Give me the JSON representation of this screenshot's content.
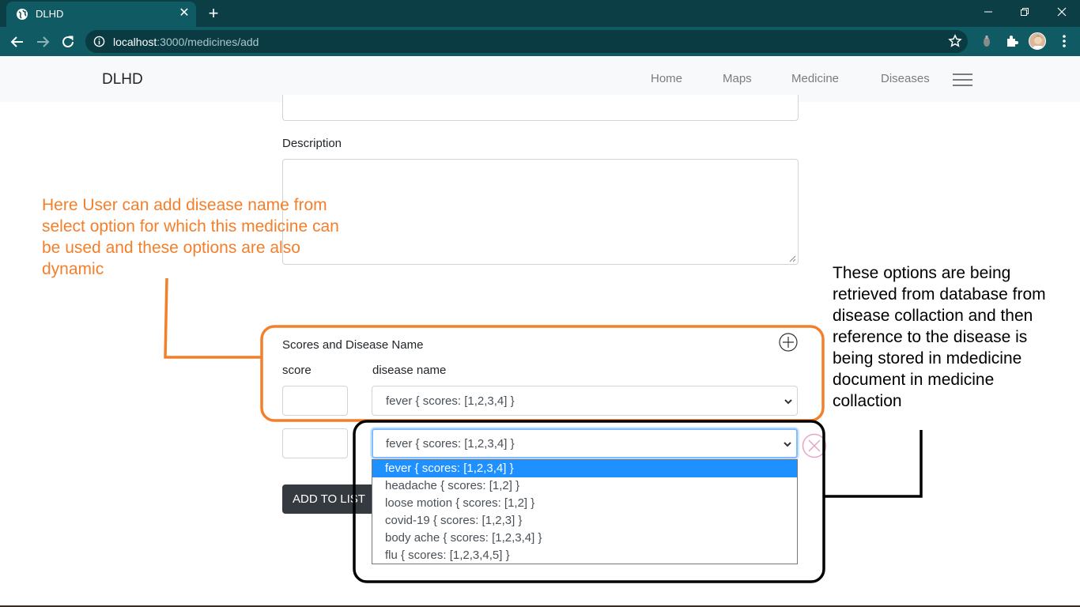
{
  "browser": {
    "tab_title": "DLHD",
    "url_host": "localhost",
    "url_path": ":3000/medicines/add",
    "icons": [
      "globe-icon",
      "close-icon",
      "plus-icon",
      "back-icon",
      "forward-icon",
      "reload-icon",
      "info-icon",
      "star-icon",
      "extension-icon",
      "puzzle-icon",
      "avatar",
      "kebab-menu-icon",
      "minimize-icon",
      "restore-icon",
      "window-close-icon"
    ]
  },
  "navbar": {
    "brand": "DLHD",
    "links": [
      "Home",
      "Maps",
      "Medicine",
      "Diseases"
    ]
  },
  "form": {
    "description_label": "Description",
    "description_value": "",
    "section_title": "Scores and Disease Name",
    "score_label": "score",
    "disease_label": "disease name",
    "rows": [
      {
        "score": "",
        "disease": "fever { scores: [1,2,3,4] }"
      },
      {
        "score": "",
        "disease": "fever { scores: [1,2,3,4] }"
      }
    ],
    "add_button": "ADD TO LIST"
  },
  "dropdown": {
    "selected": "fever { scores: [1,2,3,4] }",
    "options": [
      "fever { scores: [1,2,3,4] }",
      "headache { scores: [1,2] }",
      "loose motion { scores: [1,2] }",
      "covid-19 { scores: [1,2,3] }",
      "body ache { scores: [1,2,3,4] }",
      "flu { scores: [1,2,3,4,5] }"
    ]
  },
  "annotations": {
    "left_lines": [
      "Here User can add disease name from",
      "select option for which this medicine can",
      "be used and these options are also",
      "dynamic"
    ],
    "right_lines": [
      "These options are being",
      "retrieved from database from",
      "disease collaction and then",
      "reference to the disease is",
      "being stored in mdedicine",
      "document in medicine",
      "collaction"
    ]
  },
  "colors": {
    "tab_strip": "#0c3e45",
    "toolbar": "#105a63",
    "navbar": "#f8f9fa",
    "annotation_orange": "#f47f2a",
    "button_dark": "#343a40",
    "option_selected": "#1e90ff",
    "focus_border": "#80bdff"
  }
}
